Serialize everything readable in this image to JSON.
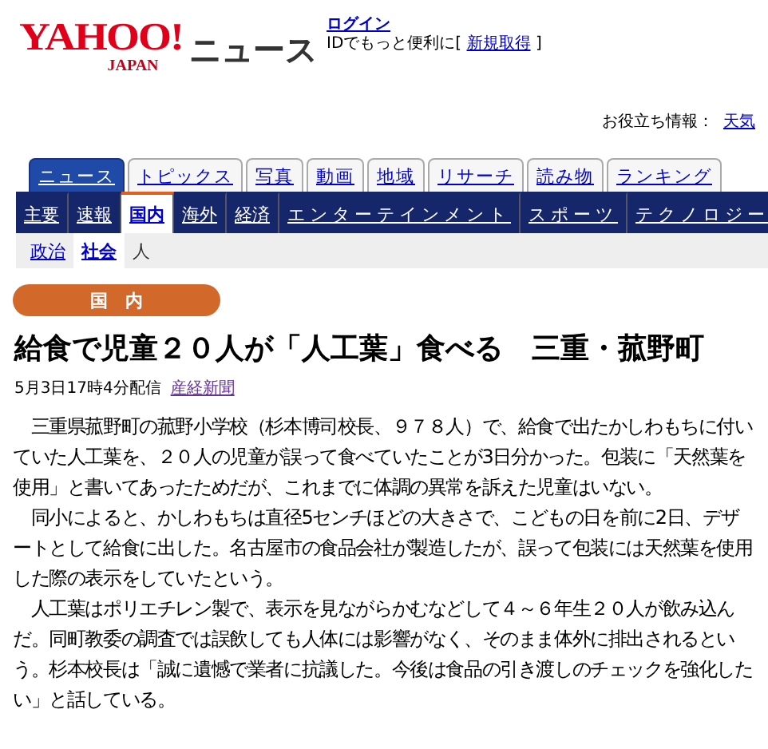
{
  "logo": {
    "brand": "YAHOO!",
    "region": "JAPAN",
    "service": "ニュース"
  },
  "account": {
    "login": "ログイン",
    "prompt": "IDでもっと便利に[",
    "signup": "新規取得",
    "close": "]"
  },
  "utility": {
    "label": "お役立ち情報：",
    "link": "天気"
  },
  "tabs": [
    {
      "label": "ニュース",
      "selected": true
    },
    {
      "label": "トピックス",
      "selected": false
    },
    {
      "label": "写真",
      "selected": false
    },
    {
      "label": "動画",
      "selected": false
    },
    {
      "label": "地域",
      "selected": false
    },
    {
      "label": "リサーチ",
      "selected": false
    },
    {
      "label": "読み物",
      "selected": false
    },
    {
      "label": "ランキング",
      "selected": false
    }
  ],
  "categories": [
    {
      "label": "主要",
      "selected": false
    },
    {
      "label": "速報",
      "selected": false
    },
    {
      "label": "国内",
      "selected": true
    },
    {
      "label": "海外",
      "selected": false
    },
    {
      "label": "経済",
      "selected": false
    },
    {
      "label": "エンターテインメント",
      "selected": false
    },
    {
      "label": "スポーツ",
      "selected": false
    },
    {
      "label": "テクノロジー",
      "selected": false
    }
  ],
  "subcategories": [
    {
      "label": "政治",
      "selected": false,
      "link": true
    },
    {
      "label": "社会",
      "selected": true,
      "link": true
    },
    {
      "label": "人",
      "selected": false,
      "link": false
    }
  ],
  "section_badge": "国　内",
  "article": {
    "headline": "給食で児童２０人が「人工葉」食べる　三重・菰野町",
    "date": "5月3日17時4分配信",
    "source": "産経新聞",
    "paragraphs": [
      "　三重県菰野町の菰野小学校（杉本博司校長、９７８人）で、給食で出たかしわもちに付いていた人工葉を、２０人の児童が誤って食べていたことが3日分かった。包装に「天然葉を使用」と書いてあったためだが、これまでに体調の異常を訴えた児童はいない。",
      "　同小によると、かしわもちは直径5センチほどの大きさで、こどもの日を前に2日、デザートとして給食に出した。名古屋市の食品会社が製造したが、誤って包装には天然葉を使用した際の表示をしていたという。",
      "　人工葉はポリエチレン製で、表示を見ながらかむなどして４～６年生２０人が飲み込んだ。同町教委の調査では誤飲しても人体には影響がなく、そのまま体外に排出されるという。杉本校長は「誠に遺憾で業者に抗議した。今後は食品の引き渡しのチェックを強化したい」と話している。"
    ]
  }
}
